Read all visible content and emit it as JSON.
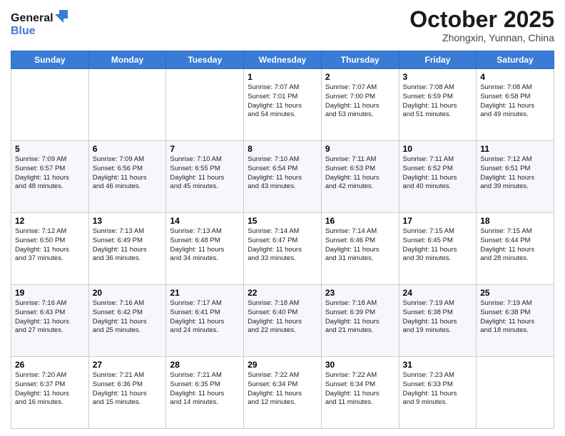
{
  "header": {
    "logo_line1": "General",
    "logo_line2": "Blue",
    "month_title": "October 2025",
    "location": "Zhongxin, Yunnan, China"
  },
  "days_of_week": [
    "Sunday",
    "Monday",
    "Tuesday",
    "Wednesday",
    "Thursday",
    "Friday",
    "Saturday"
  ],
  "weeks": [
    [
      {
        "day": "",
        "info": ""
      },
      {
        "day": "",
        "info": ""
      },
      {
        "day": "",
        "info": ""
      },
      {
        "day": "1",
        "info": "Sunrise: 7:07 AM\nSunset: 7:01 PM\nDaylight: 11 hours\nand 54 minutes."
      },
      {
        "day": "2",
        "info": "Sunrise: 7:07 AM\nSunset: 7:00 PM\nDaylight: 11 hours\nand 53 minutes."
      },
      {
        "day": "3",
        "info": "Sunrise: 7:08 AM\nSunset: 6:59 PM\nDaylight: 11 hours\nand 51 minutes."
      },
      {
        "day": "4",
        "info": "Sunrise: 7:08 AM\nSunset: 6:58 PM\nDaylight: 11 hours\nand 49 minutes."
      }
    ],
    [
      {
        "day": "5",
        "info": "Sunrise: 7:09 AM\nSunset: 6:57 PM\nDaylight: 11 hours\nand 48 minutes."
      },
      {
        "day": "6",
        "info": "Sunrise: 7:09 AM\nSunset: 6:56 PM\nDaylight: 11 hours\nand 46 minutes."
      },
      {
        "day": "7",
        "info": "Sunrise: 7:10 AM\nSunset: 6:55 PM\nDaylight: 11 hours\nand 45 minutes."
      },
      {
        "day": "8",
        "info": "Sunrise: 7:10 AM\nSunset: 6:54 PM\nDaylight: 11 hours\nand 43 minutes."
      },
      {
        "day": "9",
        "info": "Sunrise: 7:11 AM\nSunset: 6:53 PM\nDaylight: 11 hours\nand 42 minutes."
      },
      {
        "day": "10",
        "info": "Sunrise: 7:11 AM\nSunset: 6:52 PM\nDaylight: 11 hours\nand 40 minutes."
      },
      {
        "day": "11",
        "info": "Sunrise: 7:12 AM\nSunset: 6:51 PM\nDaylight: 11 hours\nand 39 minutes."
      }
    ],
    [
      {
        "day": "12",
        "info": "Sunrise: 7:12 AM\nSunset: 6:50 PM\nDaylight: 11 hours\nand 37 minutes."
      },
      {
        "day": "13",
        "info": "Sunrise: 7:13 AM\nSunset: 6:49 PM\nDaylight: 11 hours\nand 36 minutes."
      },
      {
        "day": "14",
        "info": "Sunrise: 7:13 AM\nSunset: 6:48 PM\nDaylight: 11 hours\nand 34 minutes."
      },
      {
        "day": "15",
        "info": "Sunrise: 7:14 AM\nSunset: 6:47 PM\nDaylight: 11 hours\nand 33 minutes."
      },
      {
        "day": "16",
        "info": "Sunrise: 7:14 AM\nSunset: 6:46 PM\nDaylight: 11 hours\nand 31 minutes."
      },
      {
        "day": "17",
        "info": "Sunrise: 7:15 AM\nSunset: 6:45 PM\nDaylight: 11 hours\nand 30 minutes."
      },
      {
        "day": "18",
        "info": "Sunrise: 7:15 AM\nSunset: 6:44 PM\nDaylight: 11 hours\nand 28 minutes."
      }
    ],
    [
      {
        "day": "19",
        "info": "Sunrise: 7:16 AM\nSunset: 6:43 PM\nDaylight: 11 hours\nand 27 minutes."
      },
      {
        "day": "20",
        "info": "Sunrise: 7:16 AM\nSunset: 6:42 PM\nDaylight: 11 hours\nand 25 minutes."
      },
      {
        "day": "21",
        "info": "Sunrise: 7:17 AM\nSunset: 6:41 PM\nDaylight: 11 hours\nand 24 minutes."
      },
      {
        "day": "22",
        "info": "Sunrise: 7:18 AM\nSunset: 6:40 PM\nDaylight: 11 hours\nand 22 minutes."
      },
      {
        "day": "23",
        "info": "Sunrise: 7:18 AM\nSunset: 6:39 PM\nDaylight: 11 hours\nand 21 minutes."
      },
      {
        "day": "24",
        "info": "Sunrise: 7:19 AM\nSunset: 6:38 PM\nDaylight: 11 hours\nand 19 minutes."
      },
      {
        "day": "25",
        "info": "Sunrise: 7:19 AM\nSunset: 6:38 PM\nDaylight: 11 hours\nand 18 minutes."
      }
    ],
    [
      {
        "day": "26",
        "info": "Sunrise: 7:20 AM\nSunset: 6:37 PM\nDaylight: 11 hours\nand 16 minutes."
      },
      {
        "day": "27",
        "info": "Sunrise: 7:21 AM\nSunset: 6:36 PM\nDaylight: 11 hours\nand 15 minutes."
      },
      {
        "day": "28",
        "info": "Sunrise: 7:21 AM\nSunset: 6:35 PM\nDaylight: 11 hours\nand 14 minutes."
      },
      {
        "day": "29",
        "info": "Sunrise: 7:22 AM\nSunset: 6:34 PM\nDaylight: 11 hours\nand 12 minutes."
      },
      {
        "day": "30",
        "info": "Sunrise: 7:22 AM\nSunset: 6:34 PM\nDaylight: 11 hours\nand 11 minutes."
      },
      {
        "day": "31",
        "info": "Sunrise: 7:23 AM\nSunset: 6:33 PM\nDaylight: 11 hours\nand 9 minutes."
      },
      {
        "day": "",
        "info": ""
      }
    ]
  ]
}
